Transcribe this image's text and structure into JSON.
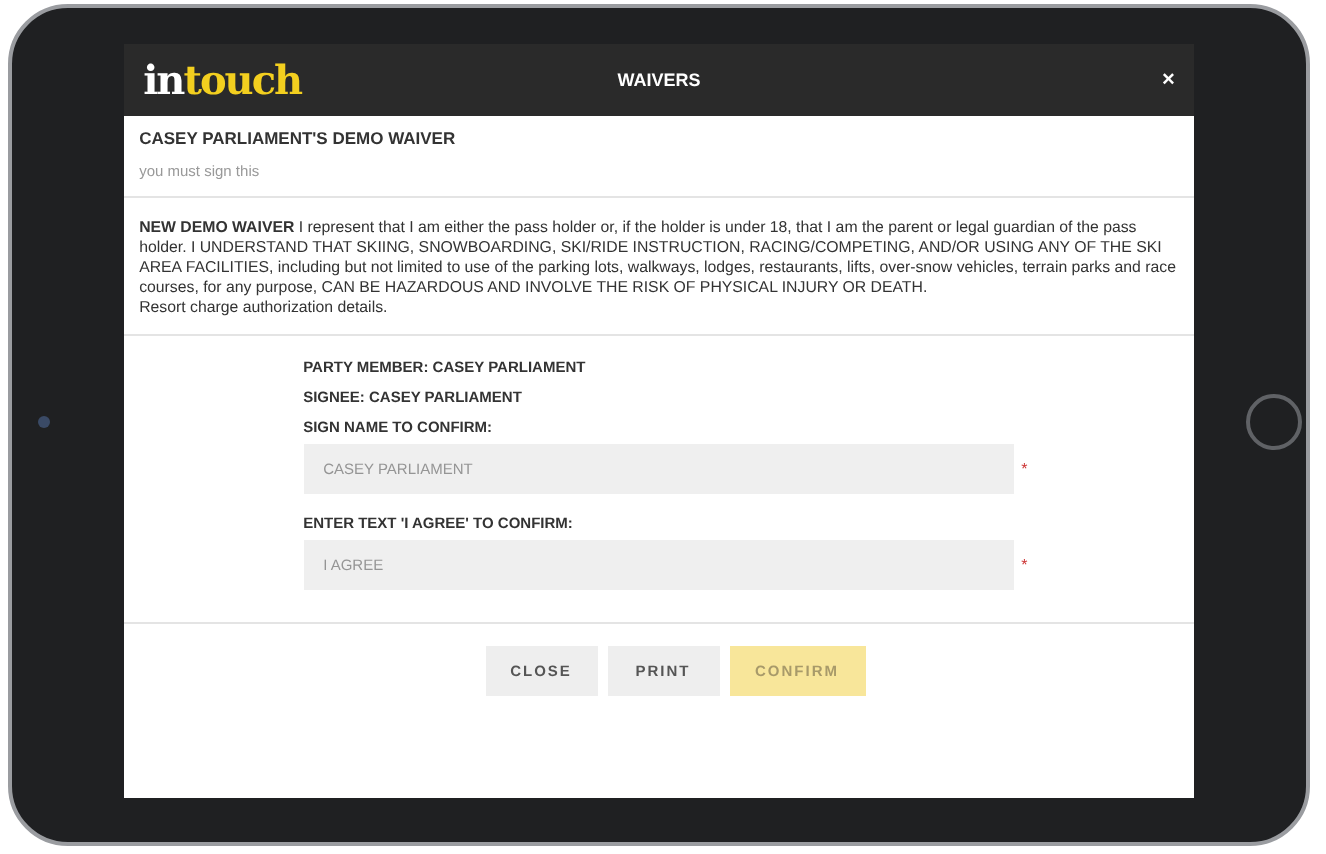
{
  "header": {
    "logo": {
      "part_1": "in",
      "part_2": "touch"
    },
    "title": "WAIVERS",
    "close": "×"
  },
  "waiver": {
    "title": "CASEY PARLIAMENT'S DEMO WAIVER",
    "subtitle": "you must sign this",
    "text": "**NEW DEMO WAIVER** I represent that I am either the pass holder or, if the holder is under 18, that I am the parent or legal guardian of the pass holder. I UNDERSTAND THAT SKIING, SNOWBOARDING, SKI/RIDE INSTRUCTION, RACING/COMPETING, AND/OR USING ANY OF THE SKI AREA FACILITIES, including but not limited to use of the parking lots, walkways, lodges, restaurants, lifts, over-snow vehicles, terrain parks and race courses, for any purpose, CAN BE HAZARDOUS AND INVOLVE THE RISK OF PHYSICAL INJURY OR DEATH.",
    "note": "Resort charge authorization details."
  },
  "form": {
    "party_member": "PARTY MEMBER: CASEY PARLIAMENT",
    "signee": "SIGNEE: CASEY PARLIAMENT",
    "fields": [
      {
        "label": "SIGN  NAME  TO CONFIRM:",
        "placeholder": "CASEY PARLIAMENT",
        "required": "*"
      },
      {
        "label": "ENTER TEXT 'I AGREE' TO CONFIRM:",
        "placeholder": "I AGREE",
        "required": "*"
      }
    ]
  },
  "buttons": [
    {
      "label": "CLOSE",
      "disabled": false
    },
    {
      "label": "PRINT",
      "disabled": false
    },
    {
      "label": "CONFIRM",
      "kind": "primary",
      "disabled": true
    }
  ]
}
